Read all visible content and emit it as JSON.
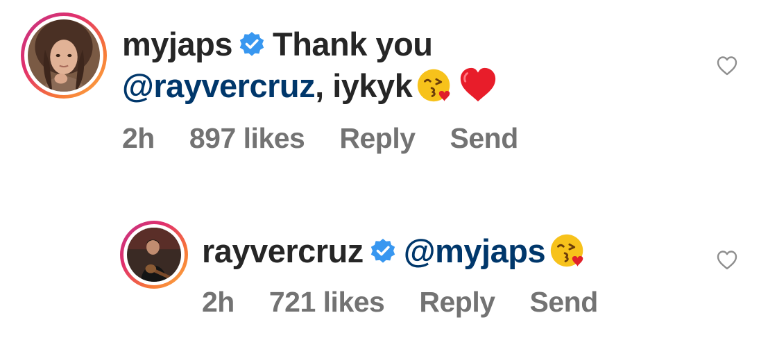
{
  "comments": [
    {
      "username": "myjaps",
      "verified": true,
      "text": "Thank you",
      "mention": "@rayvercruz",
      "text_after": ", iykyk",
      "emojis": [
        "kissing-face-emoji",
        "red-heart-emoji"
      ],
      "time": "2h",
      "likes": "897 likes",
      "reply_label": "Reply",
      "send_label": "Send"
    },
    {
      "username": "rayvercruz",
      "verified": true,
      "mention": "@myjaps",
      "emojis": [
        "kissing-face-emoji"
      ],
      "time": "2h",
      "likes": "721 likes",
      "reply_label": "Reply",
      "send_label": "Send"
    }
  ],
  "colors": {
    "text": "#262626",
    "mention": "#00376b",
    "meta": "#737373",
    "verified": "#3897f0"
  }
}
